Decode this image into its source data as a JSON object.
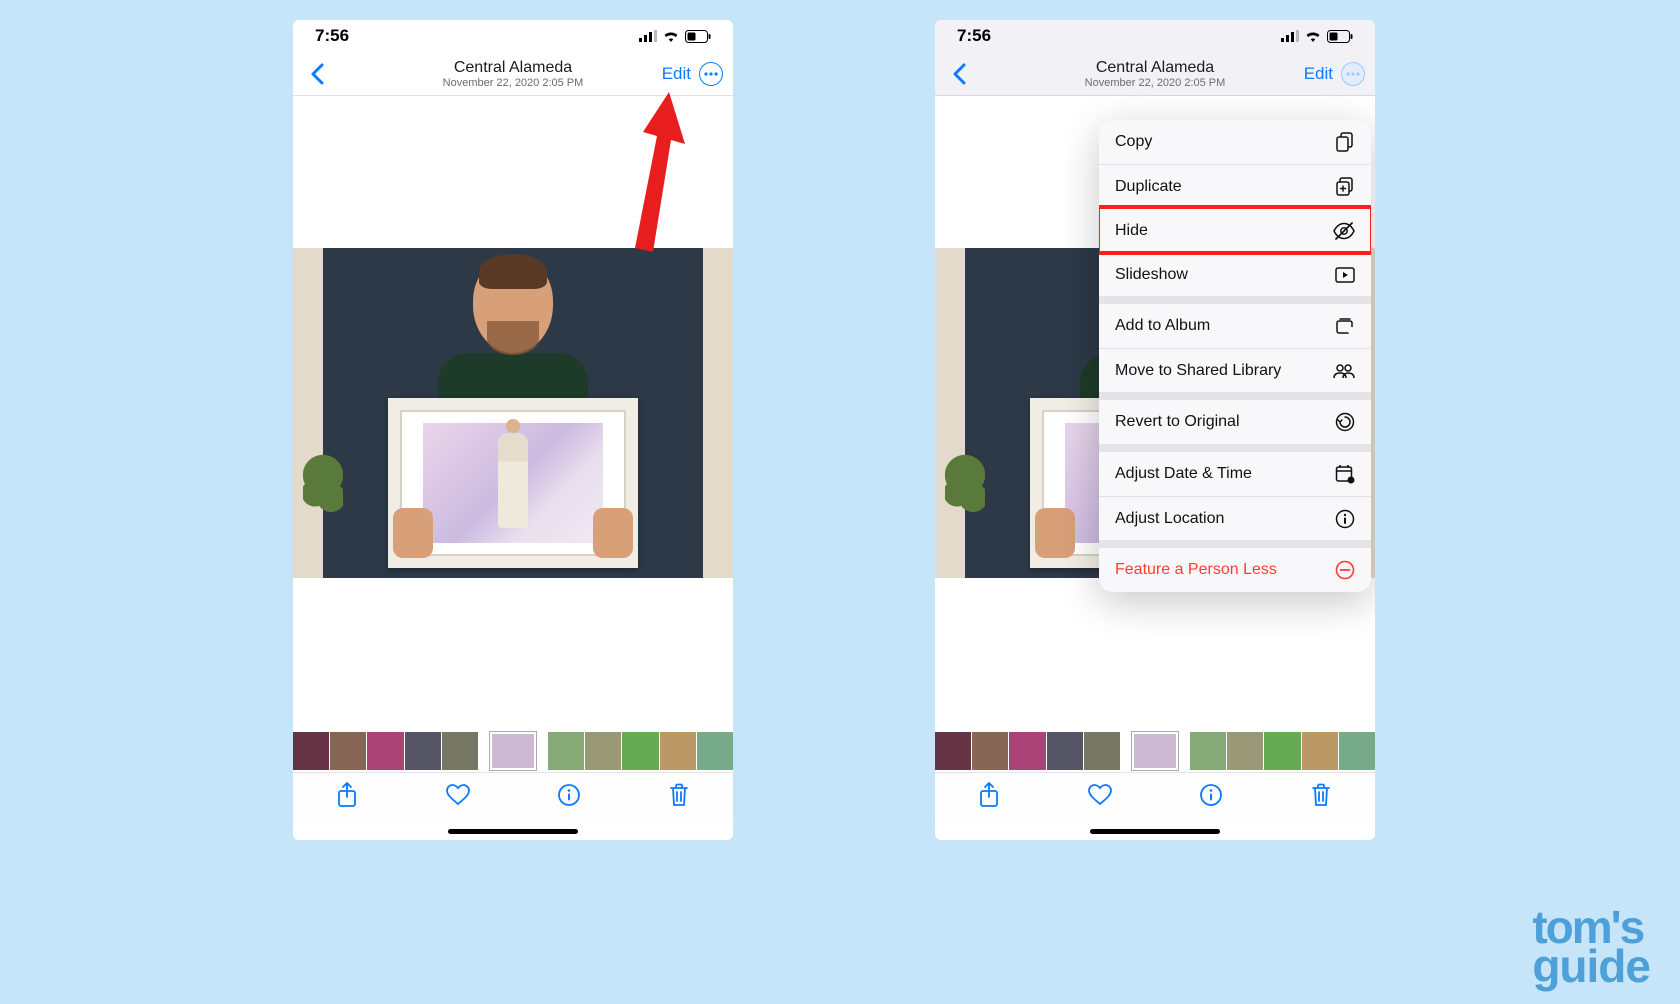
{
  "status": {
    "time": "7:56"
  },
  "nav": {
    "title": "Central Alameda",
    "subtitle": "November 22, 2020  2:05 PM",
    "edit": "Edit"
  },
  "menu": {
    "copy": "Copy",
    "duplicate": "Duplicate",
    "hide": "Hide",
    "slideshow": "Slideshow",
    "add_album": "Add to Album",
    "move_shared": "Move to Shared Library",
    "revert": "Revert to Original",
    "adjust_date": "Adjust Date & Time",
    "adjust_loc": "Adjust Location",
    "feature_less": "Feature a Person Less"
  },
  "logo": {
    "line1": "tom's",
    "line2": "guide"
  }
}
